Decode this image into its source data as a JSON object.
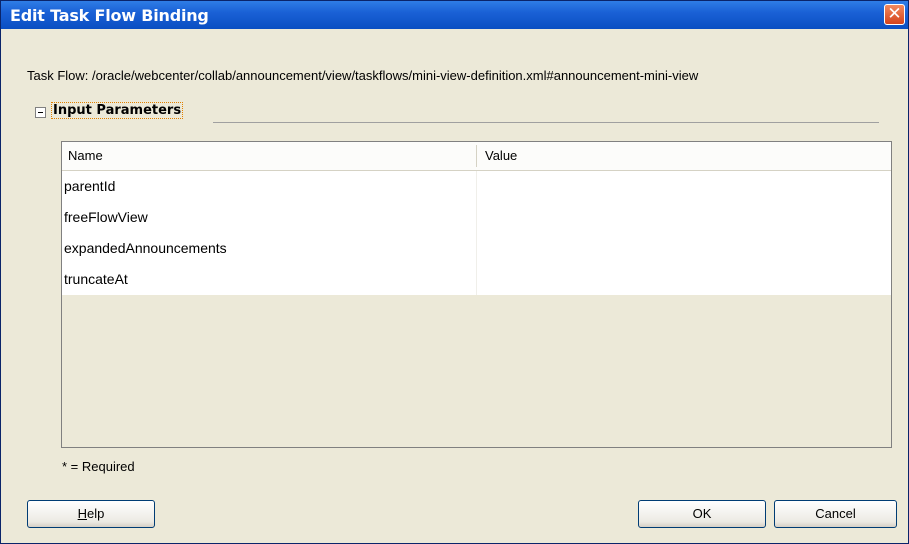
{
  "window": {
    "title": "Edit Task Flow Binding",
    "close_glyph": "✕"
  },
  "task_flow": {
    "text": "Task Flow: /oracle/webcenter/collab/announcement/view/taskflows/mini-view-definition.xml#announcement-mini-view"
  },
  "section": {
    "label": "Input Parameters",
    "expanded": true
  },
  "table": {
    "columns": [
      "Name",
      "Value"
    ],
    "rows": [
      {
        "name": "parentId",
        "value": ""
      },
      {
        "name": "freeFlowView",
        "value": ""
      },
      {
        "name": "expandedAnnouncements",
        "value": ""
      },
      {
        "name": "truncateAt",
        "value": ""
      }
    ]
  },
  "required_note": "* = Required",
  "buttons": {
    "help_first": "H",
    "help_rest": "elp",
    "ok": "OK",
    "cancel": "Cancel"
  },
  "colors": {
    "titlebar": "#0a4ec2",
    "dialog_bg": "#ece9d8",
    "close": "#d4421c",
    "focus_outline": "#e08000"
  }
}
